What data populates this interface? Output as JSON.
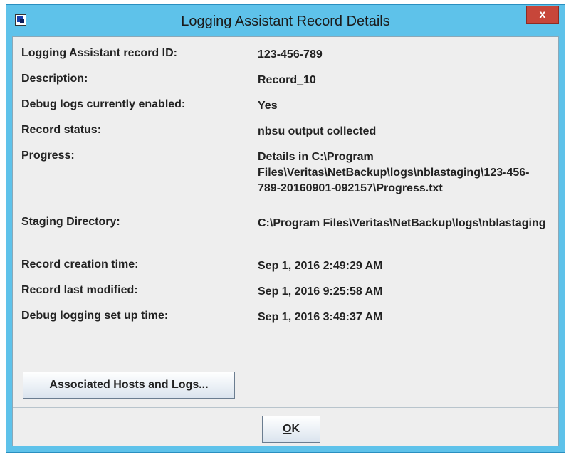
{
  "window": {
    "title": "Logging Assistant Record Details",
    "close_label": "x"
  },
  "details": [
    {
      "label": "Logging Assistant record ID:",
      "value": "123-456-789"
    },
    {
      "label": "Description:",
      "value": "Record_10"
    },
    {
      "label": "Debug logs currently enabled:",
      "value": "Yes"
    },
    {
      "label": "Record status:",
      "value": "nbsu output collected"
    },
    {
      "label": "Progress:",
      "value": "Details in C:\\Program Files\\Veritas\\NetBackup\\logs\\nblastaging\\123-456-789-20160901-092157\\Progress.txt"
    },
    {
      "label": "Staging Directory:",
      "value": "C:\\Program Files\\Veritas\\NetBackup\\logs\\nblastaging"
    },
    {
      "label": "Record creation time:",
      "value": "Sep 1, 2016 2:49:29 AM"
    },
    {
      "label": "Record last modified:",
      "value": "Sep 1, 2016 9:25:58 AM"
    },
    {
      "label": "Debug logging set up time:",
      "value": "Sep 1, 2016 3:49:37 AM"
    }
  ],
  "buttons": {
    "associated_mnemonic": "A",
    "associated_rest": "ssociated Hosts and Logs...",
    "ok_mnemonic": "O",
    "ok_rest": "K"
  },
  "colors": {
    "titlebar": "#5ec2ea",
    "close": "#c7463a",
    "client_bg": "#eeeeee"
  }
}
